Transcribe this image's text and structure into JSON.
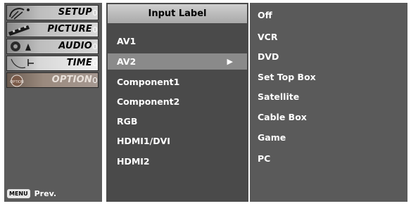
{
  "menu": {
    "items": [
      {
        "label": "SETUP",
        "icon": "satellite-dish-icon",
        "state": "normal"
      },
      {
        "label": "PICTURE",
        "icon": "film-strip-icon",
        "state": "normal"
      },
      {
        "label": "AUDIO",
        "icon": "speaker-icon",
        "state": "normal"
      },
      {
        "label": "TIME",
        "icon": "clock-icon",
        "state": "active"
      },
      {
        "label": "OPTION",
        "icon": "option-badge-icon",
        "state": "dim"
      }
    ],
    "footer_key": "MENU",
    "footer_text": "Prev."
  },
  "input_label": {
    "title": "Input Label",
    "items": [
      "AV1",
      "AV2",
      "Component1",
      "Component2",
      "RGB",
      "HDMI1/DVI",
      "HDMI2"
    ],
    "selected_index": 1,
    "arrow": "▶"
  },
  "options": {
    "items": [
      "Off",
      "VCR",
      "DVD",
      "Set Top Box",
      "Satellite",
      "Cable Box",
      "Game",
      "PC"
    ]
  },
  "colors": {
    "menu_bg": "#5b5b5b",
    "list_bg": "#4a4a4a",
    "options_bg": "#5a5a5a",
    "selection": "#8a8a8a"
  }
}
